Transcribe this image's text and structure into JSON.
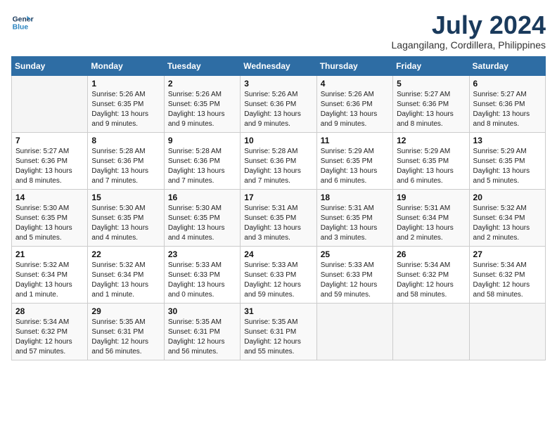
{
  "header": {
    "logo_line1": "General",
    "logo_line2": "Blue",
    "month_year": "July 2024",
    "location": "Lagangilang, Cordillera, Philippines"
  },
  "weekdays": [
    "Sunday",
    "Monday",
    "Tuesday",
    "Wednesday",
    "Thursday",
    "Friday",
    "Saturday"
  ],
  "weeks": [
    [
      {
        "num": "",
        "info": ""
      },
      {
        "num": "1",
        "info": "Sunrise: 5:26 AM\nSunset: 6:35 PM\nDaylight: 13 hours\nand 9 minutes."
      },
      {
        "num": "2",
        "info": "Sunrise: 5:26 AM\nSunset: 6:35 PM\nDaylight: 13 hours\nand 9 minutes."
      },
      {
        "num": "3",
        "info": "Sunrise: 5:26 AM\nSunset: 6:36 PM\nDaylight: 13 hours\nand 9 minutes."
      },
      {
        "num": "4",
        "info": "Sunrise: 5:26 AM\nSunset: 6:36 PM\nDaylight: 13 hours\nand 9 minutes."
      },
      {
        "num": "5",
        "info": "Sunrise: 5:27 AM\nSunset: 6:36 PM\nDaylight: 13 hours\nand 8 minutes."
      },
      {
        "num": "6",
        "info": "Sunrise: 5:27 AM\nSunset: 6:36 PM\nDaylight: 13 hours\nand 8 minutes."
      }
    ],
    [
      {
        "num": "7",
        "info": "Sunrise: 5:27 AM\nSunset: 6:36 PM\nDaylight: 13 hours\nand 8 minutes."
      },
      {
        "num": "8",
        "info": "Sunrise: 5:28 AM\nSunset: 6:36 PM\nDaylight: 13 hours\nand 7 minutes."
      },
      {
        "num": "9",
        "info": "Sunrise: 5:28 AM\nSunset: 6:36 PM\nDaylight: 13 hours\nand 7 minutes."
      },
      {
        "num": "10",
        "info": "Sunrise: 5:28 AM\nSunset: 6:36 PM\nDaylight: 13 hours\nand 7 minutes."
      },
      {
        "num": "11",
        "info": "Sunrise: 5:29 AM\nSunset: 6:35 PM\nDaylight: 13 hours\nand 6 minutes."
      },
      {
        "num": "12",
        "info": "Sunrise: 5:29 AM\nSunset: 6:35 PM\nDaylight: 13 hours\nand 6 minutes."
      },
      {
        "num": "13",
        "info": "Sunrise: 5:29 AM\nSunset: 6:35 PM\nDaylight: 13 hours\nand 5 minutes."
      }
    ],
    [
      {
        "num": "14",
        "info": "Sunrise: 5:30 AM\nSunset: 6:35 PM\nDaylight: 13 hours\nand 5 minutes."
      },
      {
        "num": "15",
        "info": "Sunrise: 5:30 AM\nSunset: 6:35 PM\nDaylight: 13 hours\nand 4 minutes."
      },
      {
        "num": "16",
        "info": "Sunrise: 5:30 AM\nSunset: 6:35 PM\nDaylight: 13 hours\nand 4 minutes."
      },
      {
        "num": "17",
        "info": "Sunrise: 5:31 AM\nSunset: 6:35 PM\nDaylight: 13 hours\nand 3 minutes."
      },
      {
        "num": "18",
        "info": "Sunrise: 5:31 AM\nSunset: 6:35 PM\nDaylight: 13 hours\nand 3 minutes."
      },
      {
        "num": "19",
        "info": "Sunrise: 5:31 AM\nSunset: 6:34 PM\nDaylight: 13 hours\nand 2 minutes."
      },
      {
        "num": "20",
        "info": "Sunrise: 5:32 AM\nSunset: 6:34 PM\nDaylight: 13 hours\nand 2 minutes."
      }
    ],
    [
      {
        "num": "21",
        "info": "Sunrise: 5:32 AM\nSunset: 6:34 PM\nDaylight: 13 hours\nand 1 minute."
      },
      {
        "num": "22",
        "info": "Sunrise: 5:32 AM\nSunset: 6:34 PM\nDaylight: 13 hours\nand 1 minute."
      },
      {
        "num": "23",
        "info": "Sunrise: 5:33 AM\nSunset: 6:33 PM\nDaylight: 13 hours\nand 0 minutes."
      },
      {
        "num": "24",
        "info": "Sunrise: 5:33 AM\nSunset: 6:33 PM\nDaylight: 12 hours\nand 59 minutes."
      },
      {
        "num": "25",
        "info": "Sunrise: 5:33 AM\nSunset: 6:33 PM\nDaylight: 12 hours\nand 59 minutes."
      },
      {
        "num": "26",
        "info": "Sunrise: 5:34 AM\nSunset: 6:32 PM\nDaylight: 12 hours\nand 58 minutes."
      },
      {
        "num": "27",
        "info": "Sunrise: 5:34 AM\nSunset: 6:32 PM\nDaylight: 12 hours\nand 58 minutes."
      }
    ],
    [
      {
        "num": "28",
        "info": "Sunrise: 5:34 AM\nSunset: 6:32 PM\nDaylight: 12 hours\nand 57 minutes."
      },
      {
        "num": "29",
        "info": "Sunrise: 5:35 AM\nSunset: 6:31 PM\nDaylight: 12 hours\nand 56 minutes."
      },
      {
        "num": "30",
        "info": "Sunrise: 5:35 AM\nSunset: 6:31 PM\nDaylight: 12 hours\nand 56 minutes."
      },
      {
        "num": "31",
        "info": "Sunrise: 5:35 AM\nSunset: 6:31 PM\nDaylight: 12 hours\nand 55 minutes."
      },
      {
        "num": "",
        "info": ""
      },
      {
        "num": "",
        "info": ""
      },
      {
        "num": "",
        "info": ""
      }
    ]
  ]
}
